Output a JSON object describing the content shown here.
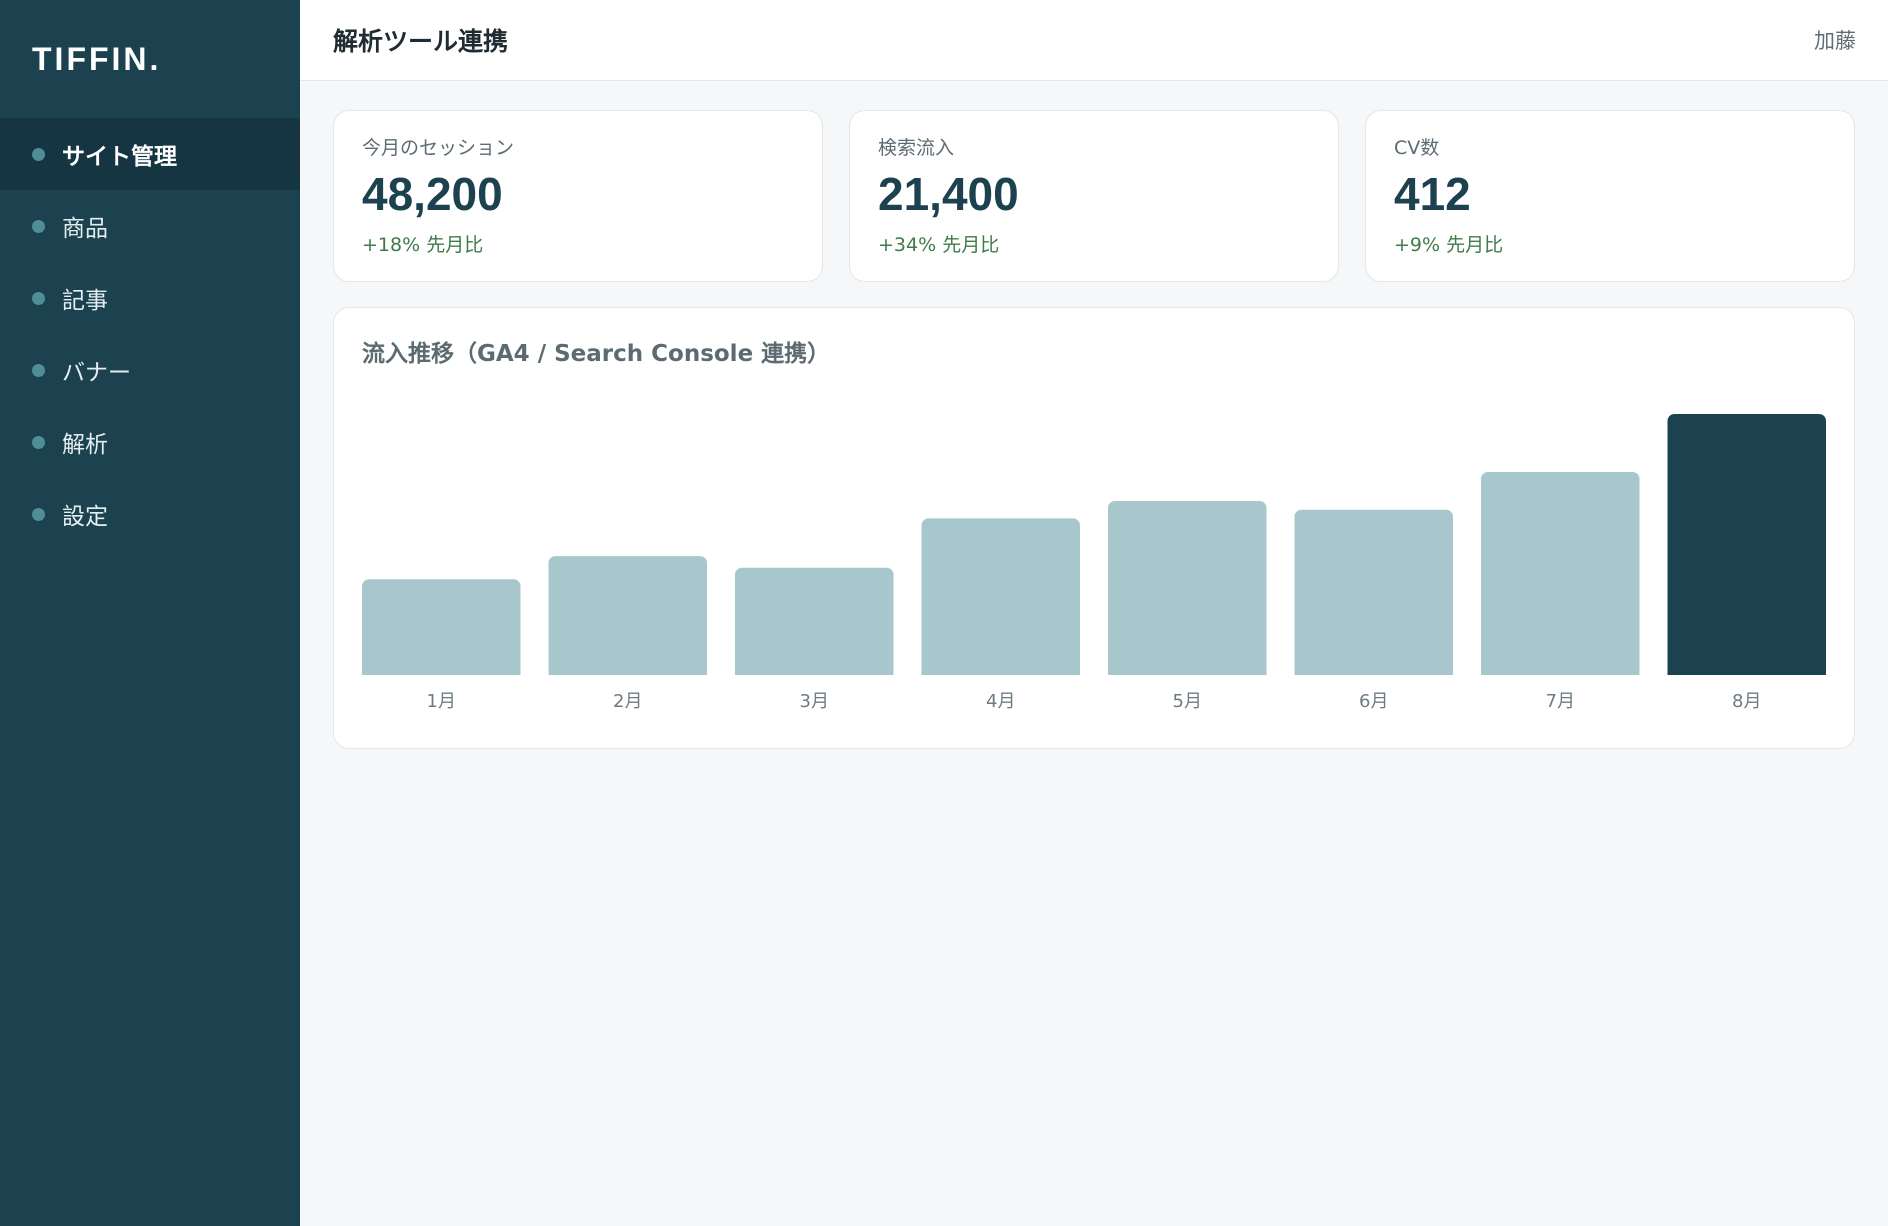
{
  "sidebar": {
    "logo": "TIFFIN.",
    "items": [
      {
        "label": "サイト管理",
        "active": true
      },
      {
        "label": "商品"
      },
      {
        "label": "記事"
      },
      {
        "label": "バナー"
      },
      {
        "label": "解析"
      },
      {
        "label": "設定"
      }
    ]
  },
  "header": {
    "title": "解析ツール連携",
    "user": "加藤"
  },
  "kpis": [
    {
      "label": "今月のセッション",
      "value": "48,200",
      "delta": "+18% 先月比"
    },
    {
      "label": "検索流入",
      "value": "21,400",
      "delta": "+34% 先月比"
    },
    {
      "label": "CV数",
      "value": "412",
      "delta": "+9% 先月比"
    }
  ],
  "colors": {
    "sidebar": "#1c424f",
    "accent": "#1c424f",
    "bar": "#a8c7cc",
    "bar_highlight": "#1c424f",
    "positive": "#3f7a4a"
  },
  "chart_data": {
    "type": "bar",
    "title": "流入推移（GA4 / Search Console 連携）",
    "categories": [
      "1月",
      "2月",
      "3月",
      "4月",
      "5月",
      "6月",
      "7月",
      "8月"
    ],
    "values": [
      33,
      41,
      37,
      54,
      60,
      57,
      70,
      90
    ],
    "ylim": [
      0,
      100
    ],
    "highlight_index": 7,
    "grid": false,
    "legend": "none"
  }
}
